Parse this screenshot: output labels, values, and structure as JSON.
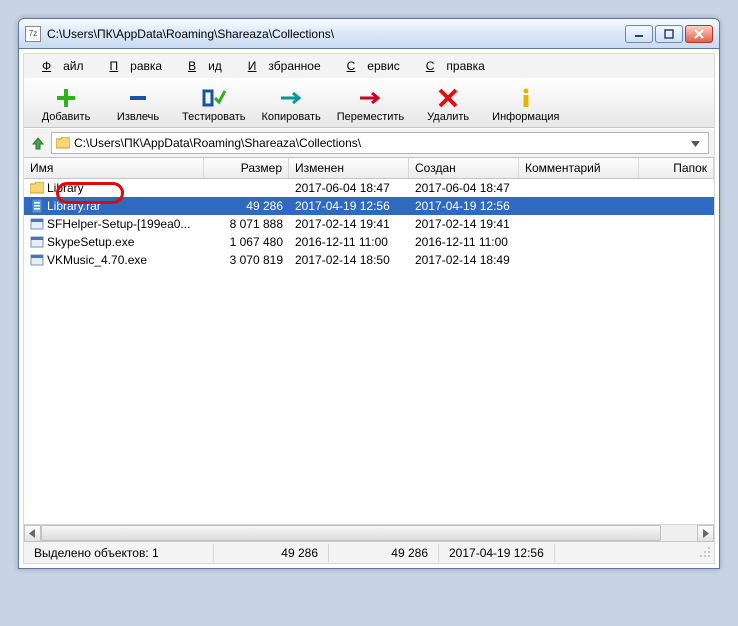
{
  "window": {
    "app_icon_label": "7z",
    "title": "C:\\Users\\ПК\\AppData\\Roaming\\Shareaza\\Collections\\"
  },
  "menu": {
    "file": "Файл",
    "edit": "Правка",
    "view": "Вид",
    "favorites": "Избранное",
    "tools": "Сервис",
    "help": "Справка"
  },
  "toolbar": {
    "add": "Добавить",
    "extract": "Извлечь",
    "test": "Тестировать",
    "copy": "Копировать",
    "move": "Переместить",
    "delete": "Удалить",
    "info": "Информация"
  },
  "path": {
    "value": "C:\\Users\\ПК\\AppData\\Roaming\\Shareaza\\Collections\\"
  },
  "columns": {
    "name": "Имя",
    "size": "Размер",
    "modified": "Изменен",
    "created": "Создан",
    "comment": "Комментарий",
    "folders": "Папок"
  },
  "rows": [
    {
      "icon": "folder",
      "name": "Library",
      "size": "",
      "modified": "2017-06-04 18:47",
      "created": "2017-06-04 18:47",
      "selected": false
    },
    {
      "icon": "rar",
      "name": "Library.rar",
      "size": "49 286",
      "modified": "2017-04-19 12:56",
      "created": "2017-04-19 12:56",
      "selected": true
    },
    {
      "icon": "exe",
      "name": "SFHelper-Setup-[199ea0...",
      "size": "8 071 888",
      "modified": "2017-02-14 19:41",
      "created": "2017-02-14 19:41",
      "selected": false
    },
    {
      "icon": "exe",
      "name": "SkypeSetup.exe",
      "size": "1 067 480",
      "modified": "2016-12-11 11:00",
      "created": "2016-12-11 11:00",
      "selected": false
    },
    {
      "icon": "exe",
      "name": "VKMusic_4.70.exe",
      "size": "3 070 819",
      "modified": "2017-02-14 18:50",
      "created": "2017-02-14 18:49",
      "selected": false
    }
  ],
  "status": {
    "selection": "Выделено объектов: 1",
    "size1": "49 286",
    "size2": "49 286",
    "date": "2017-04-19 12:56"
  },
  "colors": {
    "selection": "#2f6ac0",
    "highlight": "#e20606"
  }
}
